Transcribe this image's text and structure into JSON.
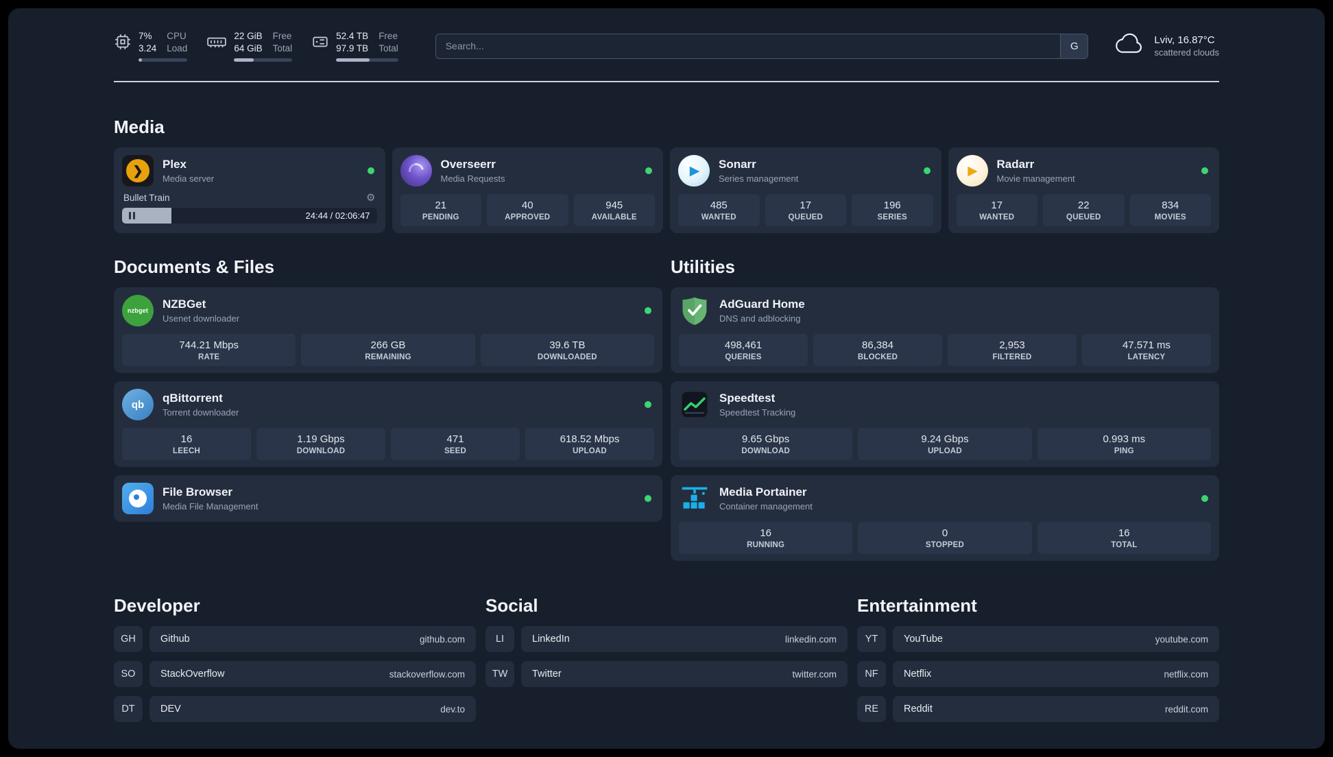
{
  "header": {
    "cpu": {
      "value_top": "7%",
      "value_bottom": "3.24",
      "label_top": "CPU",
      "label_bottom": "Load",
      "fill_percent": 7
    },
    "ram": {
      "value_top": "22 GiB",
      "value_bottom": "64 GiB",
      "label_top": "Free",
      "label_bottom": "Total",
      "fill_percent": 34
    },
    "disk": {
      "value_top": "52.4 TB",
      "value_bottom": "97.9 TB",
      "label_top": "Free",
      "label_bottom": "Total",
      "fill_percent": 54
    },
    "search": {
      "placeholder": "Search...",
      "button_label": "G"
    },
    "weather": {
      "location": "Lviv, 16.87°C",
      "condition": "scattered clouds"
    }
  },
  "icons": {
    "cpu": "cpu-chip",
    "ram": "memory-module",
    "disk": "storage-drive",
    "weather": "cloud",
    "gear": "⚙",
    "pause": "pause-bars",
    "status_dot": "online-indicator"
  },
  "colors": {
    "status_online": "#3bd671",
    "page_bg": "#171e2c",
    "card_bg": "#242d3e",
    "tile_bg": "#2b3549"
  },
  "sections": {
    "media": {
      "title": "Media",
      "plex": {
        "name": "Plex",
        "desc": "Media server",
        "track": "Bullet Train",
        "time": "24:44 / 02:06:47",
        "progress_percent": 19.5
      },
      "overseerr": {
        "name": "Overseerr",
        "desc": "Media Requests",
        "stats": [
          {
            "value": "21",
            "label": "PENDING"
          },
          {
            "value": "40",
            "label": "APPROVED"
          },
          {
            "value": "945",
            "label": "AVAILABLE"
          }
        ]
      },
      "sonarr": {
        "name": "Sonarr",
        "desc": "Series management",
        "stats": [
          {
            "value": "485",
            "label": "WANTED"
          },
          {
            "value": "17",
            "label": "QUEUED"
          },
          {
            "value": "196",
            "label": "SERIES"
          }
        ]
      },
      "radarr": {
        "name": "Radarr",
        "desc": "Movie management",
        "stats": [
          {
            "value": "17",
            "label": "WANTED"
          },
          {
            "value": "22",
            "label": "QUEUED"
          },
          {
            "value": "834",
            "label": "MOVIES"
          }
        ]
      }
    },
    "documents": {
      "title": "Documents & Files",
      "nzbget": {
        "name": "NZBGet",
        "desc": "Usenet downloader",
        "stats": [
          {
            "value": "744.21 Mbps",
            "label": "RATE"
          },
          {
            "value": "266 GB",
            "label": "REMAINING"
          },
          {
            "value": "39.6 TB",
            "label": "DOWNLOADED"
          }
        ]
      },
      "qbittorrent": {
        "name": "qBittorrent",
        "desc": "Torrent downloader",
        "stats": [
          {
            "value": "16",
            "label": "LEECH"
          },
          {
            "value": "1.19 Gbps",
            "label": "DOWNLOAD"
          },
          {
            "value": "471",
            "label": "SEED"
          },
          {
            "value": "618.52 Mbps",
            "label": "UPLOAD"
          }
        ]
      },
      "filebrowser": {
        "name": "File Browser",
        "desc": "Media File Management"
      }
    },
    "utilities": {
      "title": "Utilities",
      "adguard": {
        "name": "AdGuard Home",
        "desc": "DNS and adblocking",
        "stats": [
          {
            "value": "498,461",
            "label": "QUERIES"
          },
          {
            "value": "86,384",
            "label": "BLOCKED"
          },
          {
            "value": "2,953",
            "label": "FILTERED"
          },
          {
            "value": "47.571 ms",
            "label": "LATENCY"
          }
        ]
      },
      "speedtest": {
        "name": "Speedtest",
        "desc": "Speedtest Tracking",
        "stats": [
          {
            "value": "9.65 Gbps",
            "label": "DOWNLOAD"
          },
          {
            "value": "9.24 Gbps",
            "label": "UPLOAD"
          },
          {
            "value": "0.993 ms",
            "label": "PING"
          }
        ]
      },
      "portainer": {
        "name": "Media Portainer",
        "desc": "Container management",
        "stats": [
          {
            "value": "16",
            "label": "RUNNING"
          },
          {
            "value": "0",
            "label": "STOPPED"
          },
          {
            "value": "16",
            "label": "TOTAL"
          }
        ]
      }
    },
    "bookmarks": {
      "groups": [
        {
          "title": "Developer",
          "links": [
            {
              "abbr": "GH",
              "name": "Github",
              "url": "github.com"
            },
            {
              "abbr": "SO",
              "name": "StackOverflow",
              "url": "stackoverflow.com"
            },
            {
              "abbr": "DT",
              "name": "DEV",
              "url": "dev.to"
            }
          ]
        },
        {
          "title": "Social",
          "links": [
            {
              "abbr": "LI",
              "name": "LinkedIn",
              "url": "linkedin.com"
            },
            {
              "abbr": "TW",
              "name": "Twitter",
              "url": "twitter.com"
            }
          ]
        },
        {
          "title": "Entertainment",
          "links": [
            {
              "abbr": "YT",
              "name": "YouTube",
              "url": "youtube.com"
            },
            {
              "abbr": "NF",
              "name": "Netflix",
              "url": "netflix.com"
            },
            {
              "abbr": "RE",
              "name": "Reddit",
              "url": "reddit.com"
            }
          ]
        }
      ]
    }
  }
}
